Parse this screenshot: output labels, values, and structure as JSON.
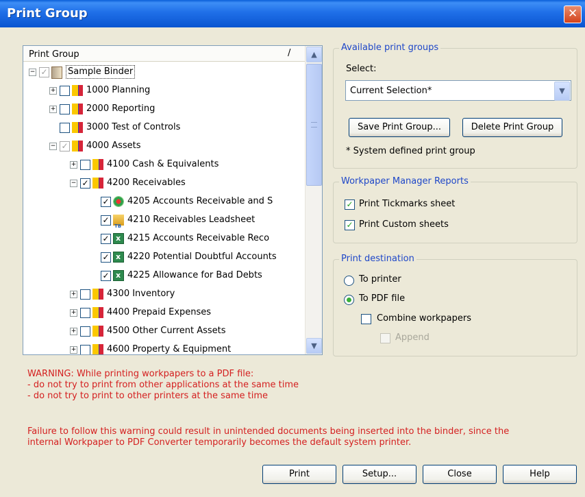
{
  "window": {
    "title": "Print Group",
    "close_glyph": "✕"
  },
  "tree": {
    "header": "Print Group",
    "sort_glyph": "/",
    "rows": [
      {
        "label": "Sample Binder",
        "expander": "−",
        "checked": "✓",
        "icon": "binder-icon"
      },
      {
        "label": "1000 Planning",
        "expander": "+",
        "checked": "",
        "icon": "folder-icon"
      },
      {
        "label": "2000 Reporting",
        "expander": "+",
        "checked": "",
        "icon": "folder-icon"
      },
      {
        "label": "3000 Test of Controls",
        "expander": "",
        "checked": "",
        "icon": "folder-icon"
      },
      {
        "label": "4000 Assets",
        "expander": "−",
        "checked": "✓",
        "icon": "folder-icon"
      },
      {
        "label": "4100 Cash & Equivalents",
        "expander": "+",
        "checked": "",
        "icon": "folder-icon"
      },
      {
        "label": "4200 Receivables",
        "expander": "−",
        "checked": "✓",
        "icon": "folder-icon"
      },
      {
        "label": "4205 Accounts Receivable and S",
        "expander": "",
        "checked": "✓",
        "icon": "checklist-icon"
      },
      {
        "label": "4210 Receivables Leadsheet",
        "expander": "",
        "checked": "✓",
        "icon": "leadsheet-tb-icon"
      },
      {
        "label": "4215 Accounts Receivable Reco",
        "expander": "",
        "checked": "✓",
        "icon": "excel-icon"
      },
      {
        "label": "4220 Potential Doubtful Accounts",
        "expander": "",
        "checked": "✓",
        "icon": "excel-icon"
      },
      {
        "label": "4225 Allowance for Bad Debts",
        "expander": "",
        "checked": "✓",
        "icon": "excel-icon"
      },
      {
        "label": "4300 Inventory",
        "expander": "+",
        "checked": "",
        "icon": "folder-icon"
      },
      {
        "label": "4400 Prepaid Expenses",
        "expander": "+",
        "checked": "",
        "icon": "folder-icon"
      },
      {
        "label": "4500 Other Current Assets",
        "expander": "+",
        "checked": "",
        "icon": "folder-icon"
      },
      {
        "label": "4600 Property & Equipment",
        "expander": "+",
        "checked": "",
        "icon": "folder-icon"
      }
    ]
  },
  "available": {
    "legend": "Available print groups",
    "select_label": "Select:",
    "selected": "Current Selection*",
    "save_button": "Save Print Group...",
    "delete_button": "Delete Print Group",
    "note": "* System defined print group"
  },
  "reports": {
    "legend": "Workpaper Manager Reports",
    "tickmarks": "Print Tickmarks sheet",
    "custom": "Print Custom sheets"
  },
  "destination": {
    "legend": "Print destination",
    "to_printer": "To printer",
    "to_pdf": "To PDF file",
    "combine": "Combine workpapers",
    "append": "Append"
  },
  "warning": {
    "line1": "WARNING: While printing workpapers to a PDF file:",
    "line2": " - do not try to print from other applications at the same time",
    "line3": " - do not try to print to other printers at the same time",
    "line4": "Failure to follow this warning could result in unintended documents being inserted into the binder, since the",
    "line5": "internal Workpaper to PDF Converter temporarily becomes the default system printer."
  },
  "buttons": {
    "print": "Print",
    "setup": "Setup...",
    "close": "Close",
    "help": "Help"
  },
  "colors": {
    "warning": "#d42020",
    "legend": "#1e47c8",
    "title_bar": "#0a55d0"
  }
}
